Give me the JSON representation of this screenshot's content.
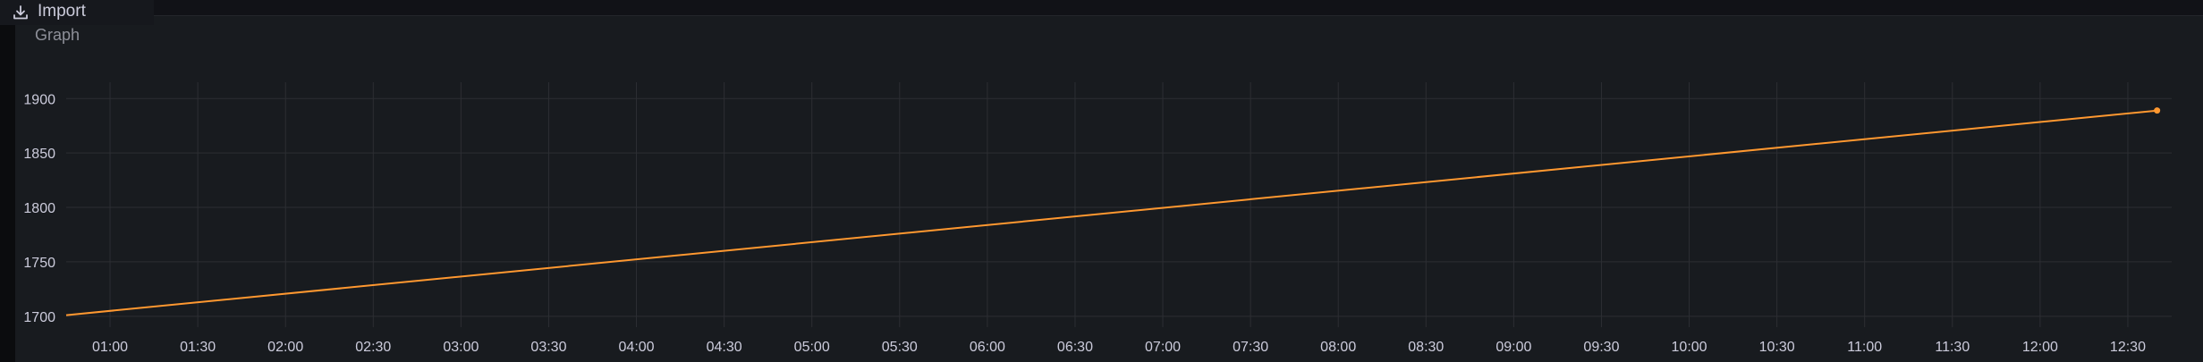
{
  "toolbar": {
    "import_label": "Import",
    "import_icon": "download-icon"
  },
  "panel": {
    "title": "Graph"
  },
  "colors": {
    "background": "#111217",
    "panel": "#181b1f",
    "grid": "#2c2e33",
    "series": "#ff9830",
    "text": "#ccccdc"
  },
  "chart_data": {
    "type": "line",
    "title": "Graph",
    "xlabel": "",
    "ylabel": "",
    "grid": true,
    "legend": "none",
    "x_range": [
      "00:45",
      "12:45"
    ],
    "ylim": [
      1690,
      1915
    ],
    "x_ticks": [
      "01:00",
      "01:30",
      "02:00",
      "02:30",
      "03:00",
      "03:30",
      "04:00",
      "04:30",
      "05:00",
      "05:30",
      "06:00",
      "06:30",
      "07:00",
      "07:30",
      "08:00",
      "08:30",
      "09:00",
      "09:30",
      "10:00",
      "10:30",
      "11:00",
      "11:30",
      "12:00",
      "12:30"
    ],
    "y_ticks": [
      1700,
      1750,
      1800,
      1850,
      1900
    ],
    "series": [
      {
        "color": "#ff9830",
        "x": [
          "00:45",
          "12:40"
        ],
        "y": [
          1701,
          1889
        ]
      }
    ]
  }
}
